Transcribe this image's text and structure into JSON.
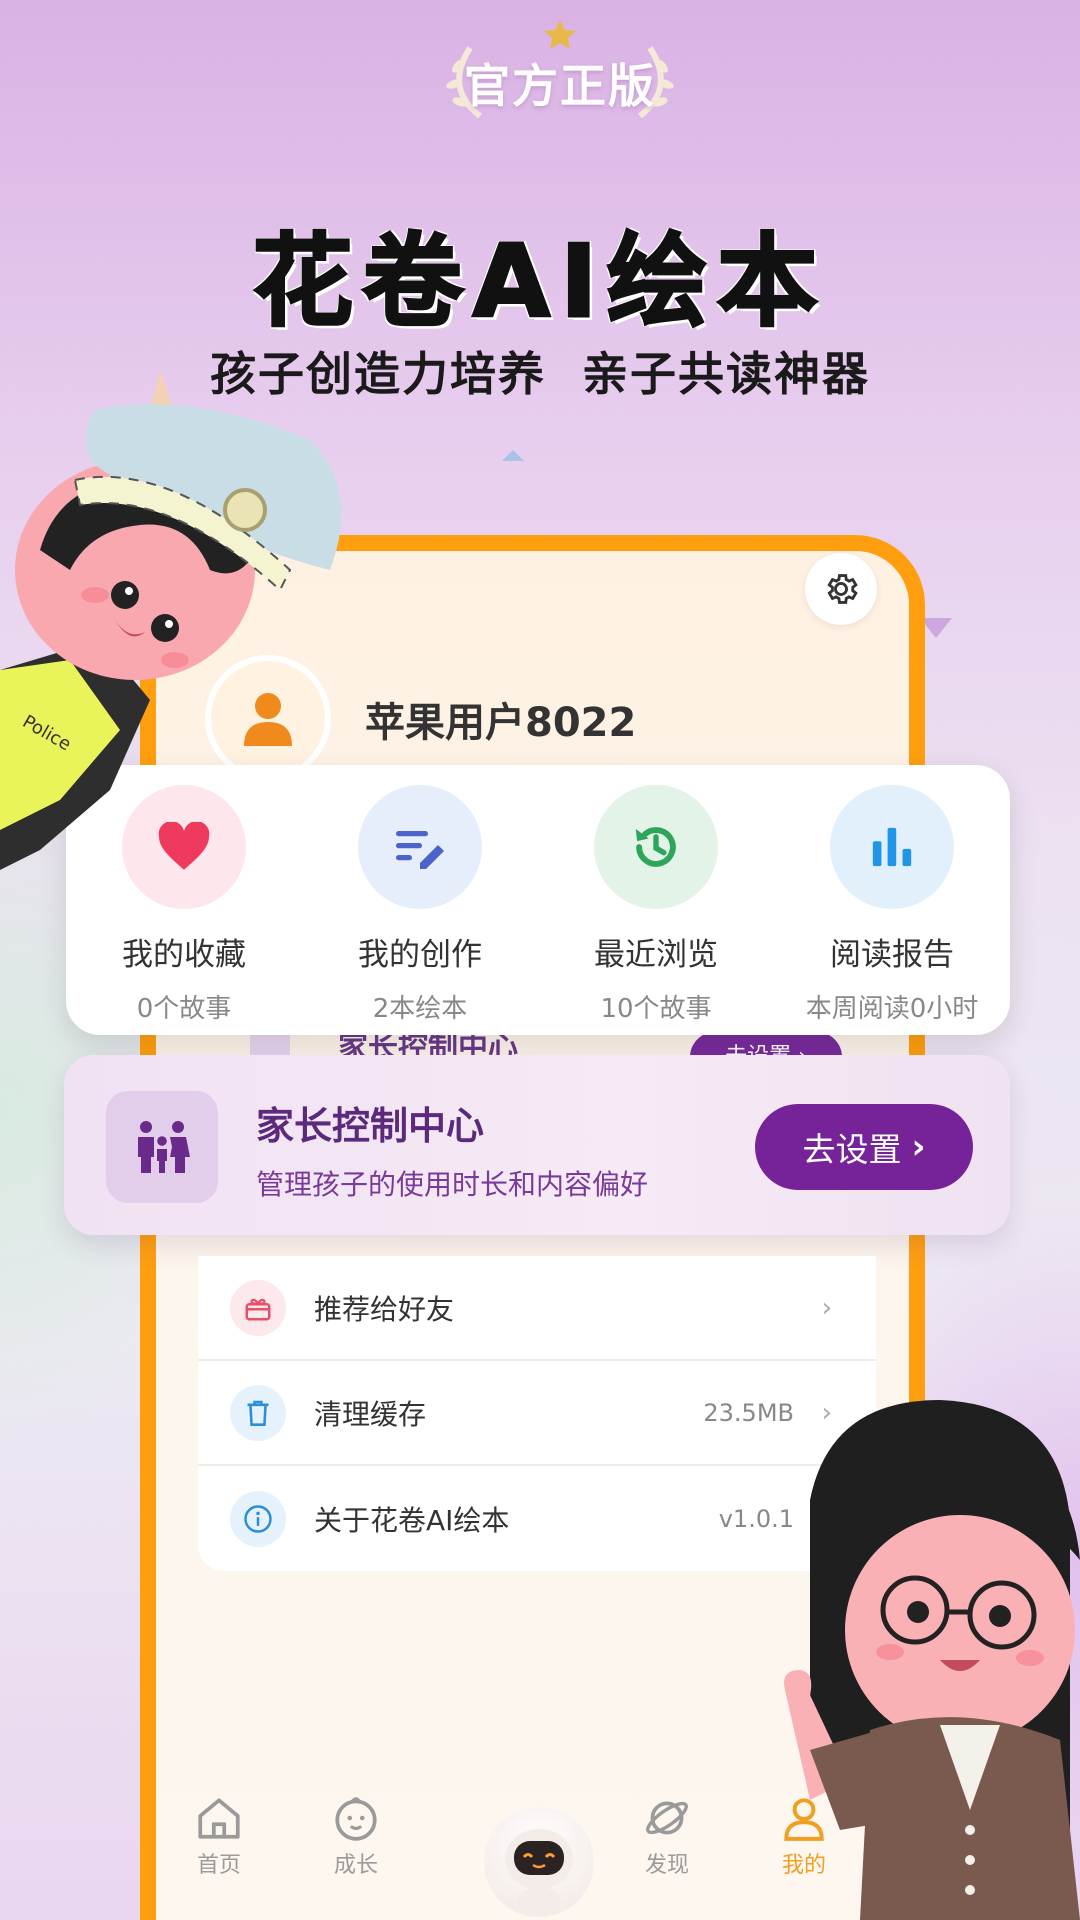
{
  "badge": {
    "text": "官方正版"
  },
  "headline": "花卷AI绘本",
  "subheadline": "孩子创造力培养  亲子共读神器",
  "profile": {
    "username": "苹果用户8022",
    "settings_icon": "gear-icon",
    "avatar_icon": "user-icon"
  },
  "stats": [
    {
      "icon": "heart-icon",
      "label": "我的收藏",
      "sub": "0个故事",
      "color": "#ef3a5d",
      "bg": "#fde7ec"
    },
    {
      "icon": "edit-list-icon",
      "label": "我的创作",
      "sub": "2本绘本",
      "color": "#4c63c9",
      "bg": "#e6eefb"
    },
    {
      "icon": "history-icon",
      "label": "最近浏览",
      "sub": "10个故事",
      "color": "#2fa55c",
      "bg": "#e4f3e8"
    },
    {
      "icon": "bar-chart-icon",
      "label": "阅读报告",
      "sub": "本周阅读0小时",
      "color": "#2196e8",
      "bg": "#e2f0fb"
    }
  ],
  "peek": {
    "title": "家长控制中心",
    "button": "去设置 ›"
  },
  "parent_control": {
    "title": "家长控制中心",
    "subtitle": "管理孩子的使用时长和内容偏好",
    "button": "去设置",
    "button_chevron": "›",
    "icon": "family-icon"
  },
  "menu": [
    {
      "icon": "gift-icon",
      "label": "推荐给好友",
      "value": "",
      "chevron": "›",
      "color": "#e8506a",
      "bg": "#fde8ec"
    },
    {
      "icon": "trash-icon",
      "label": "清理缓存",
      "value": "23.5MB",
      "chevron": "›",
      "color": "#2a8fd8",
      "bg": "#e5f1fb"
    },
    {
      "icon": "info-icon",
      "label": "关于花卷AI绘本",
      "value": "v1.0.1",
      "chevron": "",
      "color": "#2a8fd8",
      "bg": "#e5f1fb"
    }
  ],
  "nav": [
    {
      "icon": "home-icon",
      "label": "首页",
      "active": false
    },
    {
      "icon": "baby-face-icon",
      "label": "成长",
      "active": false
    },
    {
      "icon": "robot-icon",
      "label": "",
      "active": false
    },
    {
      "icon": "planet-icon",
      "label": "发现",
      "active": false
    },
    {
      "icon": "person-icon",
      "label": "我的",
      "active": true
    }
  ],
  "colors": {
    "accent_orange": "#ff9f10",
    "purple": "#76239a",
    "active_nav": "#f0a020"
  },
  "illustrations": {
    "police_badge_text": "Police"
  }
}
